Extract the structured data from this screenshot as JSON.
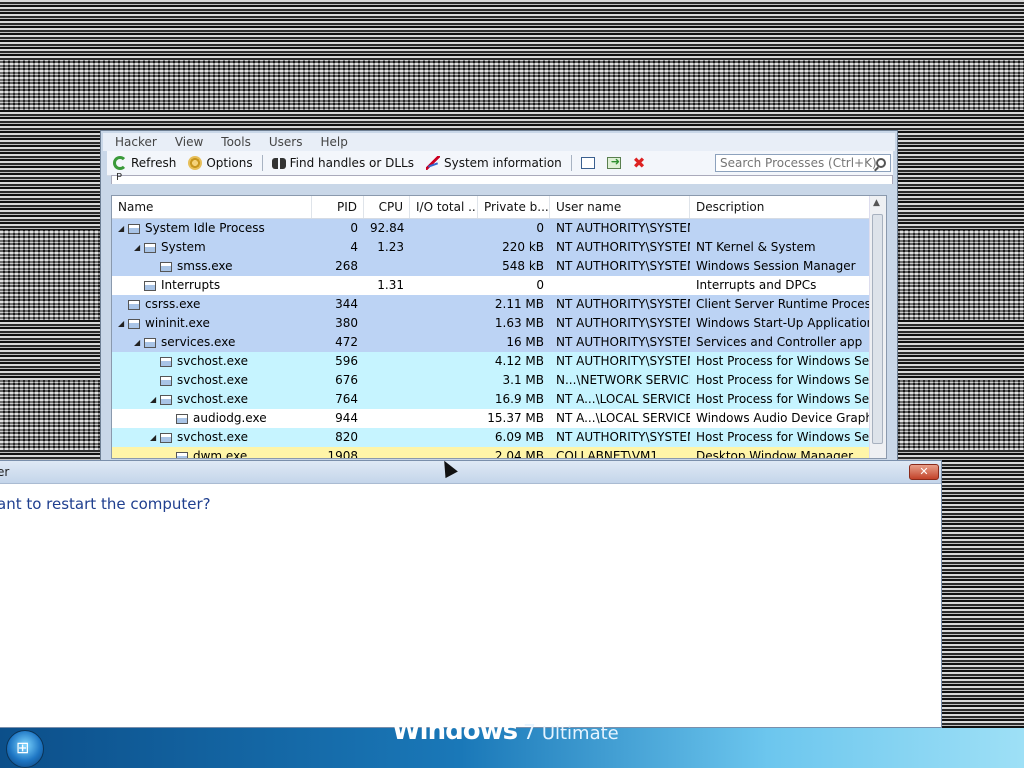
{
  "menu": [
    "Hacker",
    "View",
    "Tools",
    "Users",
    "Help"
  ],
  "toolbar": {
    "refresh": "Refresh",
    "options": "Options",
    "find_handles": "Find handles or DLLs",
    "system_information": "System information",
    "search_placeholder": "Search Processes (Ctrl+K)"
  },
  "tab_fragment": "P",
  "columns": [
    "Name",
    "PID",
    "CPU",
    "I/O total ...",
    "Private b...",
    "User name",
    "Description"
  ],
  "colors": {
    "service": "#c6f4ff",
    "system": "#bcd3f4",
    "own": "#fff5a8",
    "plain": "#ffffff"
  },
  "rows": [
    {
      "indent": 0,
      "expander": "◢",
      "name": "System Idle Process",
      "pid": "0",
      "cpu": "92.84",
      "io": "",
      "private": "0",
      "user": "NT AUTHORITY\\SYSTEM",
      "desc": "",
      "color": "#bcd3f4"
    },
    {
      "indent": 1,
      "expander": "◢",
      "name": "System",
      "pid": "4",
      "cpu": "1.23",
      "io": "",
      "private": "220 kB",
      "user": "NT AUTHORITY\\SYSTEM",
      "desc": "NT Kernel & System",
      "color": "#bcd3f4"
    },
    {
      "indent": 2,
      "expander": "",
      "name": "smss.exe",
      "pid": "268",
      "cpu": "",
      "io": "",
      "private": "548 kB",
      "user": "NT AUTHORITY\\SYSTEM",
      "desc": "Windows Session Manager",
      "color": "#bcd3f4"
    },
    {
      "indent": 1,
      "expander": "",
      "name": "Interrupts",
      "pid": "",
      "cpu": "1.31",
      "io": "",
      "private": "0",
      "user": "",
      "desc": "Interrupts and DPCs",
      "color": "#ffffff"
    },
    {
      "indent": 0,
      "expander": "",
      "name": "csrss.exe",
      "pid": "344",
      "cpu": "",
      "io": "",
      "private": "2.11 MB",
      "user": "NT AUTHORITY\\SYSTEM",
      "desc": "Client Server Runtime Process",
      "color": "#bcd3f4"
    },
    {
      "indent": 0,
      "expander": "◢",
      "name": "wininit.exe",
      "pid": "380",
      "cpu": "",
      "io": "",
      "private": "1.63 MB",
      "user": "NT AUTHORITY\\SYSTEM",
      "desc": "Windows Start-Up Application",
      "color": "#bcd3f4"
    },
    {
      "indent": 1,
      "expander": "◢",
      "name": "services.exe",
      "pid": "472",
      "cpu": "",
      "io": "",
      "private": "16 MB",
      "user": "NT AUTHORITY\\SYSTEM",
      "desc": "Services and Controller app",
      "color": "#bcd3f4"
    },
    {
      "indent": 2,
      "expander": "",
      "name": "svchost.exe",
      "pid": "596",
      "cpu": "",
      "io": "",
      "private": "4.12 MB",
      "user": "NT AUTHORITY\\SYSTEM",
      "desc": "Host Process for Windows Ser...",
      "color": "#c6f4ff"
    },
    {
      "indent": 2,
      "expander": "",
      "name": "svchost.exe",
      "pid": "676",
      "cpu": "",
      "io": "",
      "private": "3.1 MB",
      "user": "N...\\NETWORK SERVICE",
      "desc": "Host Process for Windows Ser...",
      "color": "#c6f4ff"
    },
    {
      "indent": 2,
      "expander": "◢",
      "name": "svchost.exe",
      "pid": "764",
      "cpu": "",
      "io": "",
      "private": "16.9 MB",
      "user": "NT A...\\LOCAL SERVICE",
      "desc": "Host Process for Windows Ser...",
      "color": "#c6f4ff"
    },
    {
      "indent": 3,
      "expander": "",
      "name": "audiodg.exe",
      "pid": "944",
      "cpu": "",
      "io": "",
      "private": "15.37 MB",
      "user": "NT A...\\LOCAL SERVICE",
      "desc": "Windows Audio Device Graph...",
      "color": "#ffffff"
    },
    {
      "indent": 2,
      "expander": "◢",
      "name": "svchost.exe",
      "pid": "820",
      "cpu": "",
      "io": "",
      "private": "6.09 MB",
      "user": "NT AUTHORITY\\SYSTEM",
      "desc": "Host Process for Windows Ser...",
      "color": "#c6f4ff"
    },
    {
      "indent": 3,
      "expander": "",
      "name": "dwm.exe",
      "pid": "1908",
      "cpu": "",
      "io": "",
      "private": "2.04 MB",
      "user": "COLLABNET\\VM1",
      "desc": "Desktop Window Manager",
      "color": "#fff5a8"
    }
  ],
  "dialog": {
    "title": "er",
    "close": "✕",
    "question": "ant to restart the computer?"
  },
  "taskbar": {
    "brand": "Windows",
    "version": "7",
    "edition": "Ultimate",
    "start_glyph": "⊞"
  }
}
